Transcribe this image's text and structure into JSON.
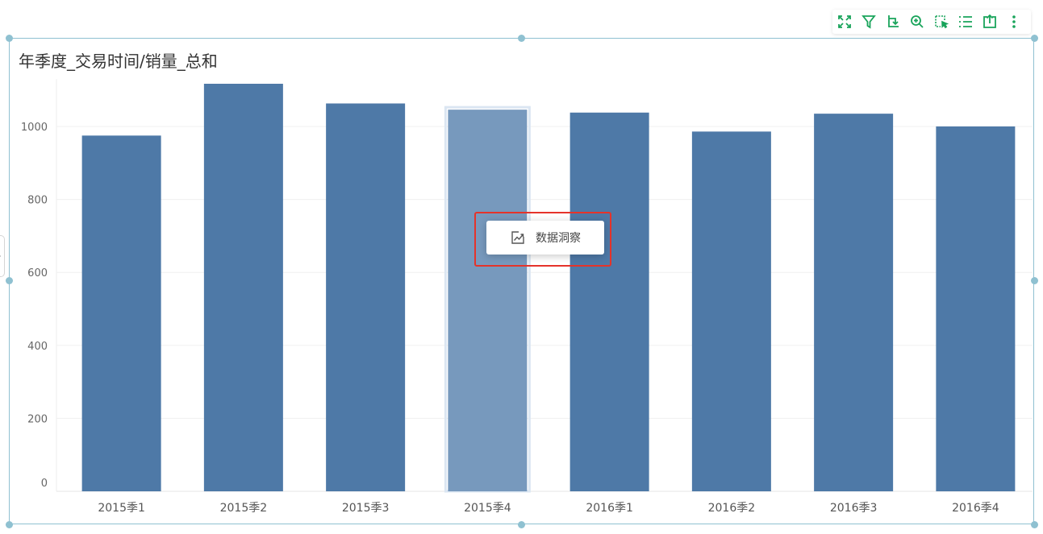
{
  "toolbar": {
    "items": [
      {
        "icon": "fullscreen-icon"
      },
      {
        "icon": "filter-icon"
      },
      {
        "icon": "drill-icon"
      },
      {
        "icon": "zoom-in-icon"
      },
      {
        "icon": "select-icon"
      },
      {
        "icon": "list-icon"
      },
      {
        "icon": "export-icon"
      },
      {
        "icon": "more-icon"
      }
    ],
    "accent_color": "#19a45b"
  },
  "popup": {
    "label": "数据洞察",
    "icon": "insight-icon"
  },
  "chart_data": {
    "type": "bar",
    "title": "年季度_交易时间/销量_总和",
    "categories": [
      "2015季1",
      "2015季2",
      "2015季3",
      "2015季4",
      "2016季1",
      "2016季2",
      "2016季3",
      "2016季4"
    ],
    "values": [
      975,
      1117,
      1063,
      1046,
      1038,
      986,
      1035,
      1000
    ],
    "yticks": [
      0,
      200,
      400,
      600,
      800,
      1000
    ],
    "ylim": [
      0,
      1130
    ],
    "highlighted_index": 3,
    "bar_color": "#4e79a7",
    "highlight_color": "#7799bd",
    "grid": true,
    "xlabel": "",
    "ylabel": ""
  }
}
